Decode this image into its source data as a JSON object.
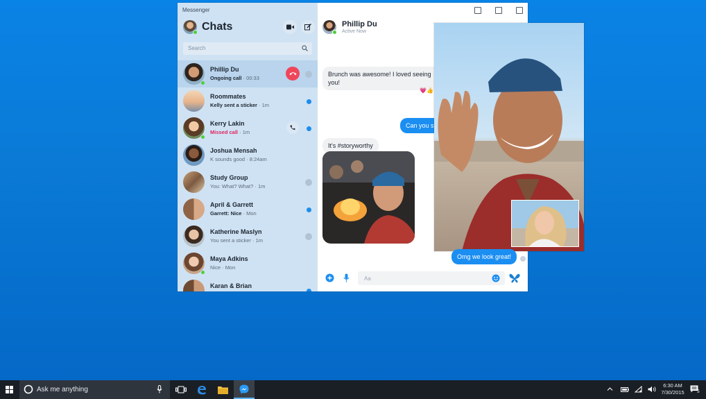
{
  "app": {
    "title": "Messenger"
  },
  "sidebar": {
    "header_title": "Chats",
    "search_placeholder": "Search",
    "conversations": [
      {
        "name": "Phillip Du",
        "sub": "Ongoing call",
        "time": "00:33",
        "state": "active-call"
      },
      {
        "name": "Roommates",
        "sub": "Kelly sent a sticker",
        "time": "1m",
        "state": "unread"
      },
      {
        "name": "Kerry Lakin",
        "sub": "Missed call",
        "time": "1m",
        "state": "missed"
      },
      {
        "name": "Joshua Mensah",
        "sub": "K sounds good",
        "time": "8:24am",
        "state": "unread"
      },
      {
        "name": "Study Group",
        "sub": "You: What? What?",
        "time": "1m",
        "state": "read"
      },
      {
        "name": "April & Garrett",
        "sub": "Garrett: Nice",
        "time": "Mon",
        "state": "unread"
      },
      {
        "name": "Katherine Maslyn",
        "sub": "You sent a sticker",
        "time": "1m",
        "state": "read"
      },
      {
        "name": "Maya Adkins",
        "sub": "Nice",
        "time": "Mon",
        "state": "none"
      },
      {
        "name": "Karan & Brian",
        "sub": "",
        "time": "",
        "state": "unread"
      }
    ]
  },
  "conversation": {
    "contact_name": "Phillip Du",
    "contact_status": "Active Now",
    "messages": {
      "incoming_1": "Brunch was awesome! I loved seeing you!",
      "reaction_1": "💗👍",
      "outgoing_1": "Can you s",
      "incoming_2": "It's #storyworthy",
      "outgoing_2": "Omg we look great!"
    },
    "composer_placeholder": "Aa"
  },
  "taskbar": {
    "search_text": "Ask me anything",
    "time": "6:30 AM",
    "date": "7/30/2015",
    "notification_count": "5"
  },
  "colors": {
    "accent": "#1b8ef2",
    "sidebar_bg": "#cfe2f3",
    "end_call": "#f0465a",
    "missed": "#e0245e",
    "desktop": "#0a7ad6",
    "taskbar": "#1a1f26"
  },
  "icons": [
    "video-camera-icon",
    "compose-icon",
    "search-icon",
    "end-call-icon",
    "phone-icon",
    "plus-icon",
    "microphone-icon",
    "emoji-icon",
    "butterfly-sticker-icon",
    "windows-start-icon",
    "cortana-icon",
    "task-view-icon",
    "edge-icon",
    "file-explorer-icon",
    "messenger-icon",
    "chevron-up-icon",
    "battery-icon",
    "wifi-icon",
    "volume-icon",
    "notification-icon"
  ]
}
